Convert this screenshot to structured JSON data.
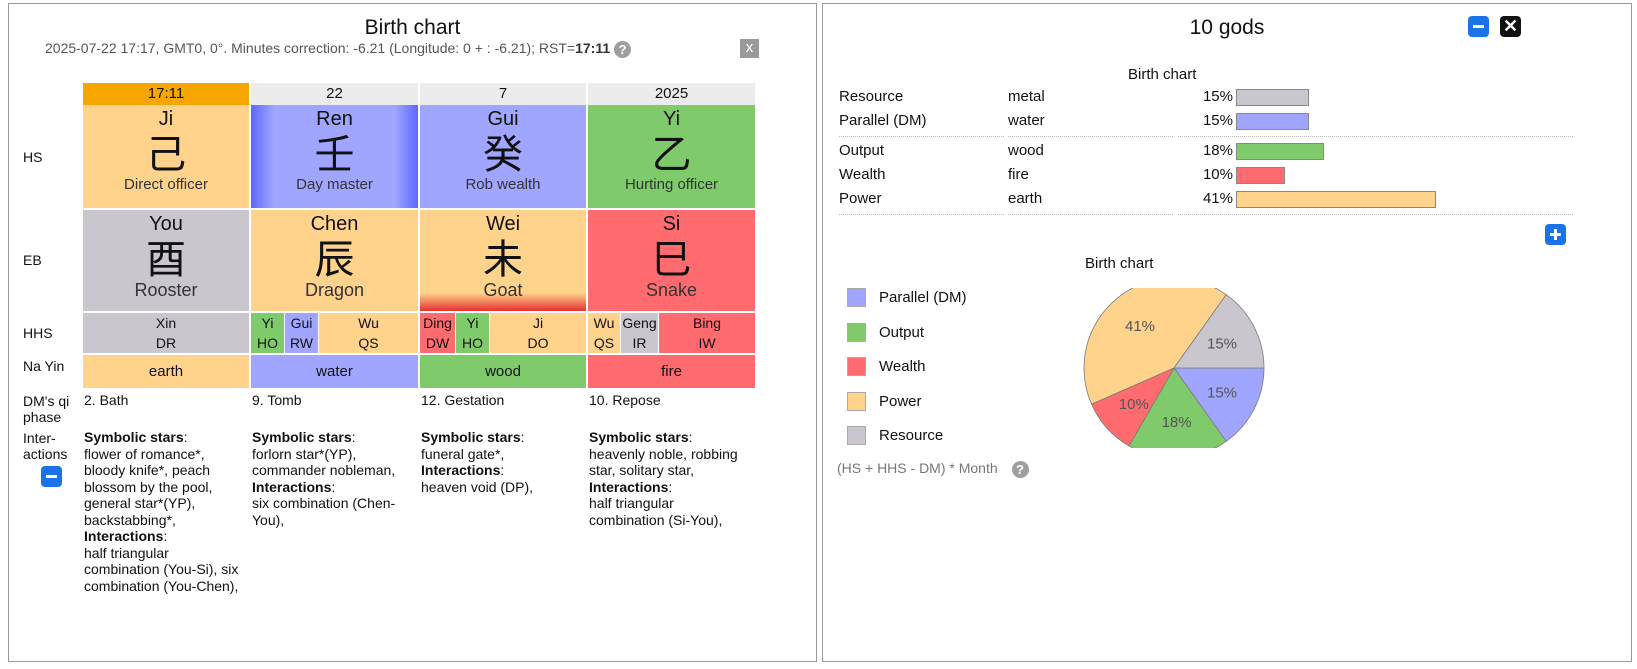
{
  "left": {
    "title": "Birth chart",
    "subtitle_main": "2025-07-22 17:17, GMT0, 0°. Minutes correction: -6.21 (Longitude: 0 + : -6.21); RST=",
    "subtitle_rst": "17:11",
    "help_icon": "?",
    "close_label": "x",
    "row_labels": {
      "hs": "HS",
      "eb": "EB",
      "hhs": "HHS",
      "nayin": "Na Yin",
      "phase": "DM's qi phase",
      "inter": "Inter-actions"
    },
    "pillars": [
      {
        "header": "17:11",
        "hs": {
          "pinyin": "Ji",
          "char": "己",
          "god": "Direct officer",
          "color": "#ffd38c"
        },
        "eb": {
          "pinyin": "You",
          "char": "酉",
          "animal": "Rooster",
          "color": "#c9c6ce"
        },
        "hhs": [
          {
            "stem": "Xin",
            "god": "DR",
            "color": "#c9c6ce"
          }
        ],
        "nayin": "earth",
        "phase": "2. Bath",
        "stars_label": "Symbolic stars",
        "stars": "flower of romance*, bloody knife*, peach blossom by the pool, general star*(YP), backstabbing*,",
        "inter_label": "Interactions",
        "interactions": "half triangular combination (You-Si), six combination (You-Chen),"
      },
      {
        "header": "22",
        "hs": {
          "pinyin": "Ren",
          "char": "壬",
          "god": "Day master",
          "color": "#a0a6ff"
        },
        "eb": {
          "pinyin": "Chen",
          "char": "辰",
          "animal": "Dragon",
          "color": "#ffd38c"
        },
        "hhs": [
          {
            "stem": "Yi",
            "god": "HO",
            "color": "#7fca6a"
          },
          {
            "stem": "Gui",
            "god": "RW",
            "color": "#a0a6ff"
          },
          {
            "stem": "Wu",
            "god": "QS",
            "color": "#ffd38c"
          }
        ],
        "nayin": "water",
        "phase": "9. Tomb",
        "stars_label": "Symbolic stars",
        "stars": "forlorn star*(YP), commander nobleman,",
        "inter_label": "Interactions",
        "interactions": "six combination (Chen-You),"
      },
      {
        "header": "7",
        "hs": {
          "pinyin": "Gui",
          "char": "癸",
          "god": "Rob wealth",
          "color": "#a0a6ff"
        },
        "eb": {
          "pinyin": "Wei",
          "char": "未",
          "animal": "Goat",
          "color": "#ffd38c"
        },
        "hhs": [
          {
            "stem": "Ding",
            "god": "DW",
            "color": "#ff6b6f"
          },
          {
            "stem": "Yi",
            "god": "HO",
            "color": "#7fca6a"
          },
          {
            "stem": "Ji",
            "god": "DO",
            "color": "#ffd38c"
          }
        ],
        "nayin": "wood",
        "phase": "12. Gestation",
        "stars_label": "Symbolic stars",
        "stars": "funeral gate*,",
        "inter_label": "Interactions",
        "interactions": "heaven void (DP),"
      },
      {
        "header": "2025",
        "hs": {
          "pinyin": "Yi",
          "char": "乙",
          "god": "Hurting officer",
          "color": "#7fca6a"
        },
        "eb": {
          "pinyin": "Si",
          "char": "巳",
          "animal": "Snake",
          "color": "#ff6b6f"
        },
        "hhs": [
          {
            "stem": "Wu",
            "god": "QS",
            "color": "#ffd38c"
          },
          {
            "stem": "Geng",
            "god": "IR",
            "color": "#c9c6ce"
          },
          {
            "stem": "Bing",
            "god": "IW",
            "color": "#ff6b6f"
          }
        ],
        "nayin": "fire",
        "phase": "10. Repose",
        "stars_label": "Symbolic stars",
        "stars": "heavenly noble, robbing star, solitary star,",
        "inter_label": "Interactions",
        "interactions": "half triangular combination (Si-You),"
      }
    ]
  },
  "right": {
    "title": "10 gods",
    "table_caption": "Birth chart",
    "gods": [
      {
        "name": "Resource",
        "element": "metal",
        "pct": 15,
        "color": "#c9c6ce"
      },
      {
        "name": "Parallel (DM)",
        "element": "water",
        "pct": 15,
        "color": "#a0a6ff"
      },
      {
        "name": "Output",
        "element": "wood",
        "pct": 18,
        "color": "#7fca6a"
      },
      {
        "name": "Wealth",
        "element": "fire",
        "pct": 10,
        "color": "#ff6b6f"
      },
      {
        "name": "Power",
        "element": "earth",
        "pct": 41,
        "color": "#ffd38c"
      }
    ],
    "pct_suffix": "%",
    "legend": [
      {
        "label": "Parallel (DM)",
        "color": "#a0a6ff"
      },
      {
        "label": "Output",
        "color": "#7fca6a"
      },
      {
        "label": "Wealth",
        "color": "#ff6b6f"
      },
      {
        "label": "Power",
        "color": "#ffd38c"
      },
      {
        "label": "Resource",
        "color": "#c9c6ce"
      }
    ],
    "formula": "(HS + HHS - DM) * Month",
    "help_icon": "?",
    "chart_data": {
      "type": "pie",
      "title": "Birth chart",
      "slices": [
        {
          "name": "Parallel (DM)",
          "value": 15,
          "color": "#a0a6ff"
        },
        {
          "name": "Output",
          "value": 18,
          "color": "#7fca6a"
        },
        {
          "name": "Wealth",
          "value": 10,
          "color": "#ff6b6f"
        },
        {
          "name": "Power",
          "value": 41,
          "color": "#ffd38c"
        },
        {
          "name": "Resource",
          "value": 15,
          "color": "#c9c6ce"
        }
      ]
    }
  }
}
